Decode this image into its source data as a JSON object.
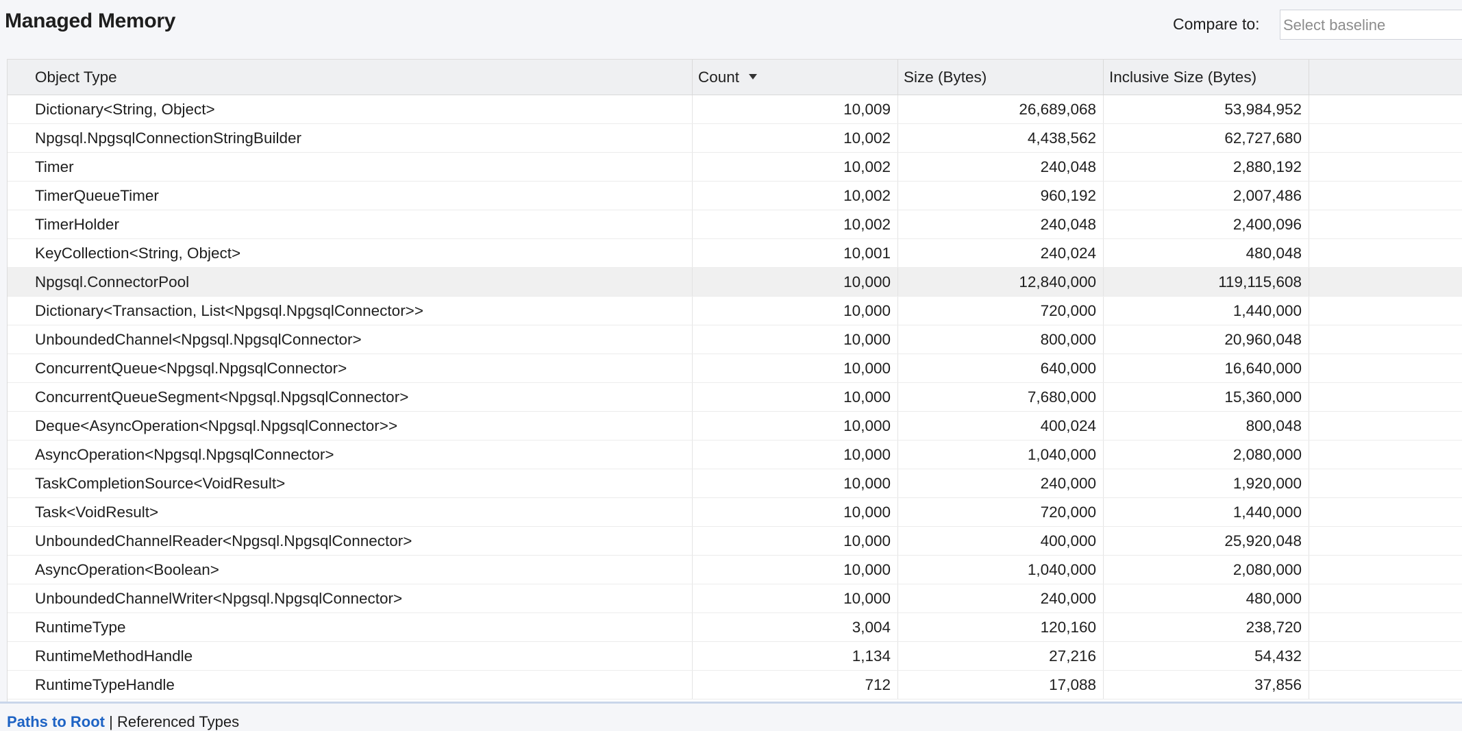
{
  "header": {
    "title": "Managed Memory",
    "compare_label": "Compare to:",
    "baseline_placeholder": "Select baseline"
  },
  "table": {
    "columns": [
      "Object Type",
      "Count",
      "Size (Bytes)",
      "Inclusive Size (Bytes)"
    ],
    "sort_column": "Count",
    "sort_direction": "descending",
    "selected_row": 6,
    "rows": [
      [
        "Dictionary<String, Object>",
        "10,009",
        "26,689,068",
        "53,984,952"
      ],
      [
        "Npgsql.NpgsqlConnectionStringBuilder",
        "10,002",
        "4,438,562",
        "62,727,680"
      ],
      [
        "Timer",
        "10,002",
        "240,048",
        "2,880,192"
      ],
      [
        "TimerQueueTimer",
        "10,002",
        "960,192",
        "2,007,486"
      ],
      [
        "TimerHolder",
        "10,002",
        "240,048",
        "2,400,096"
      ],
      [
        "KeyCollection<String, Object>",
        "10,001",
        "240,024",
        "480,048"
      ],
      [
        "Npgsql.ConnectorPool",
        "10,000",
        "12,840,000",
        "119,115,608"
      ],
      [
        "Dictionary<Transaction, List<Npgsql.NpgsqlConnector>>",
        "10,000",
        "720,000",
        "1,440,000"
      ],
      [
        "UnboundedChannel<Npgsql.NpgsqlConnector>",
        "10,000",
        "800,000",
        "20,960,048"
      ],
      [
        "ConcurrentQueue<Npgsql.NpgsqlConnector>",
        "10,000",
        "640,000",
        "16,640,000"
      ],
      [
        "ConcurrentQueueSegment<Npgsql.NpgsqlConnector>",
        "10,000",
        "7,680,000",
        "15,360,000"
      ],
      [
        "Deque<AsyncOperation<Npgsql.NpgsqlConnector>>",
        "10,000",
        "400,024",
        "800,048"
      ],
      [
        "AsyncOperation<Npgsql.NpgsqlConnector>",
        "10,000",
        "1,040,000",
        "2,080,000"
      ],
      [
        "TaskCompletionSource<VoidResult>",
        "10,000",
        "240,000",
        "1,920,000"
      ],
      [
        "Task<VoidResult>",
        "10,000",
        "720,000",
        "1,440,000"
      ],
      [
        "UnboundedChannelReader<Npgsql.NpgsqlConnector>",
        "10,000",
        "400,000",
        "25,920,048"
      ],
      [
        "AsyncOperation<Boolean>",
        "10,000",
        "1,040,000",
        "2,080,000"
      ],
      [
        "UnboundedChannelWriter<Npgsql.NpgsqlConnector>",
        "10,000",
        "240,000",
        "480,000"
      ],
      [
        "RuntimeType",
        "3,004",
        "120,160",
        "238,720"
      ],
      [
        "RuntimeMethodHandle",
        "1,134",
        "27,216",
        "54,432"
      ],
      [
        "RuntimeTypeHandle",
        "712",
        "17,088",
        "37,856"
      ]
    ]
  },
  "bottom_tabs": {
    "paths_to_root": "Paths to Root",
    "separator": "|",
    "referenced_types": "Referenced Types"
  },
  "colors": {
    "accent": "#1e63c4",
    "background": "#f5f6f9",
    "grid_background": "#ffffff",
    "header_background": "#eff0f2",
    "selected_row": "#f0f0f0"
  }
}
